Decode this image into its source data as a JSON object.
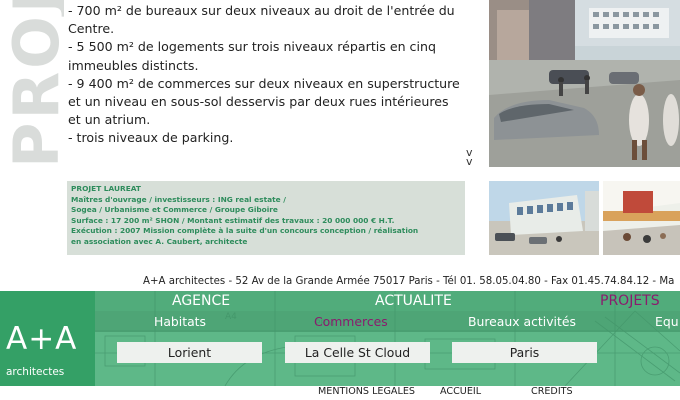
{
  "section_word": "PROJETS",
  "description_lines": [
    "- 700 m² de bureaux sur deux niveaux au droit de l'entrée du",
    "Centre.",
    "- 5 500 m² de logements sur trois niveaux répartis en cinq",
    "immeubles distincts.",
    "- 9 400 m² de commerces sur deux niveaux en superstructure",
    "et un niveau en sous-sol desservis par deux rues intérieures",
    "et un atrium.",
    "- trois niveaux de parking."
  ],
  "more_glyph": "v\nv",
  "laureat": {
    "title": "PROJET LAUREAT",
    "lines": [
      "Maîtres d'ouvrage / investisseurs : ING real estate /",
      "Sogea / Urbanisme et Commerce / Groupe Giboire",
      "Surface : 17 200 m² SHON / Montant estimatif des travaux : 20 000 000 € H.T.",
      "Exécution : 2007  Mission complète à la suite d'un concours conception / réalisation",
      "en association avec A. Caubert, architecte"
    ]
  },
  "address": "A+A architectes - 52 Av de la Grande Armée 75017 Paris - Tél 01. 58.05.04.80 - Fax 01.45.74.84.12 - Ma",
  "logo": {
    "mark": "A+A",
    "word": "architectes"
  },
  "main_menu": [
    "AGENCE",
    "ACTUALITE",
    "PROJETS"
  ],
  "sub_menu": [
    "Habitats",
    "Commerces",
    "Bureaux activités",
    "Equ"
  ],
  "city_tabs": [
    "Lorient",
    "La Celle St Cloud",
    "Paris"
  ],
  "footer_links": [
    "MENTIONS LEGALES",
    "ACCUEIL",
    "CREDITS"
  ],
  "colors": {
    "accent_green": "#34a066",
    "nav_green": "#5eb888",
    "active_purple": "#8a1c6e",
    "laureat_text": "#2e8c5c"
  }
}
